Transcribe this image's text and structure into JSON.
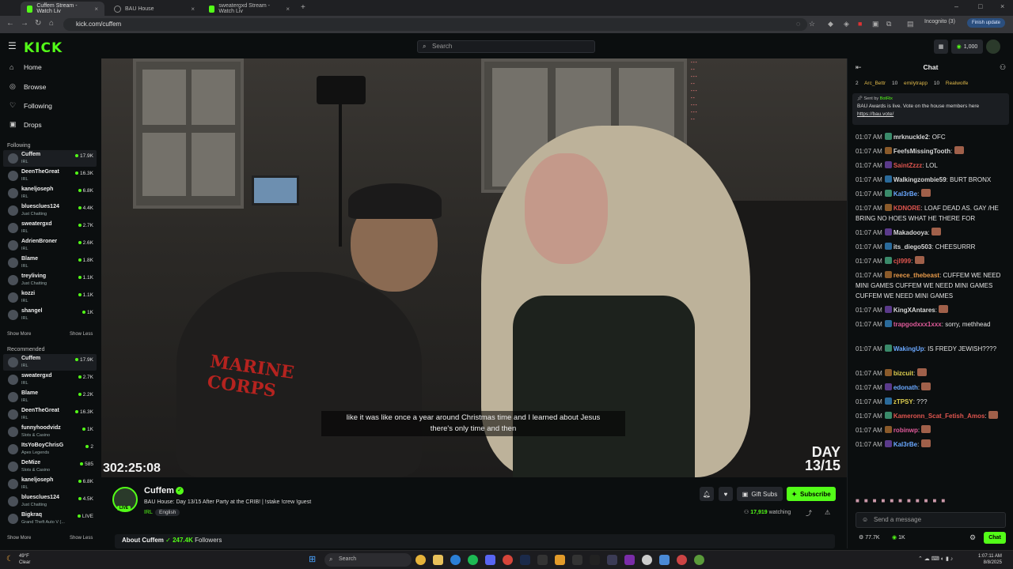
{
  "browser": {
    "tabs": [
      {
        "title": "Cuffem Stream - Watch Liv",
        "active": true
      },
      {
        "title": "BAU House",
        "active": false
      },
      {
        "title": "sweatergxd Stream - Watch Liv",
        "active": false
      }
    ],
    "url": "kick.com/cuffem",
    "incognito_label": "Incognito (3)",
    "finish_update": "Finish update"
  },
  "header": {
    "logo": "KICK",
    "search_placeholder": "Search",
    "balance": "1,000"
  },
  "sidebar": {
    "nav": [
      {
        "label": "Home",
        "icon": "home-icon"
      },
      {
        "label": "Browse",
        "icon": "compass-icon"
      },
      {
        "label": "Following",
        "icon": "heart-icon"
      },
      {
        "label": "Drops",
        "icon": "gift-icon"
      }
    ],
    "following_title": "Following",
    "following": [
      {
        "name": "Cuffem",
        "cat": "IRL",
        "viewers": "17.9K"
      },
      {
        "name": "DeenTheGreat",
        "cat": "IRL",
        "viewers": "16.3K"
      },
      {
        "name": "kaneljoseph",
        "cat": "IRL",
        "viewers": "6.8K"
      },
      {
        "name": "bluesclues124",
        "cat": "Just Chatting",
        "viewers": "4.4K"
      },
      {
        "name": "sweatergxd",
        "cat": "IRL",
        "viewers": "2.7K"
      },
      {
        "name": "AdrienBroner",
        "cat": "IRL",
        "viewers": "2.6K"
      },
      {
        "name": "Blame",
        "cat": "IRL",
        "viewers": "1.8K"
      },
      {
        "name": "treyliving",
        "cat": "Just Chatting",
        "viewers": "1.1K"
      },
      {
        "name": "kozzi",
        "cat": "IRL",
        "viewers": "1.1K"
      },
      {
        "name": "shangel",
        "cat": "IRL",
        "viewers": "1K"
      }
    ],
    "show_more": "Show More",
    "show_less": "Show Less",
    "recommended_title": "Recommended",
    "recommended": [
      {
        "name": "Cuffem",
        "cat": "IRL",
        "viewers": "17.9K"
      },
      {
        "name": "sweatergxd",
        "cat": "IRL",
        "viewers": "2.7K"
      },
      {
        "name": "Blame",
        "cat": "IRL",
        "viewers": "2.2K"
      },
      {
        "name": "DeenTheGreat",
        "cat": "IRL",
        "viewers": "16.3K"
      },
      {
        "name": "funnyhoodvidz",
        "cat": "Slots & Casino",
        "viewers": "1K"
      },
      {
        "name": "ItsYoBoyChrisG",
        "cat": "Apex Legends",
        "viewers": "2"
      },
      {
        "name": "DeMize",
        "cat": "Slots & Casino",
        "viewers": "585"
      },
      {
        "name": "kaneljoseph",
        "cat": "IRL",
        "viewers": "6.8K"
      },
      {
        "name": "bluesclues124",
        "cat": "Just Chatting",
        "viewers": "4.5K"
      },
      {
        "name": "Bigkraq",
        "cat": "Grand Theft Auto V (...",
        "viewers": "LIVE"
      }
    ]
  },
  "video": {
    "subtitle_line1": "like it was like once a year around Christmas time and I learned about Jesus",
    "subtitle_line2": "there's only time and then",
    "timer": "302:25:08",
    "day_badge_1": "DAY",
    "day_badge_2": "13/15",
    "shirt_text": "MARINE CORPS"
  },
  "stream": {
    "name": "Cuffem",
    "live": "LIVE",
    "title": "BAU House: Day 13/15 After Party at the CRIB! | !stake !crew !guest",
    "category": "IRL",
    "language": "English",
    "gift_subs": "Gift Subs",
    "subscribe": "Subscribe",
    "watching_count": "17,919",
    "watching_label": "watching",
    "about_prefix": "About Cuffem",
    "followers_count": "247.4K",
    "followers_label": "Followers"
  },
  "chat": {
    "title": "Chat",
    "gifters": [
      "2",
      "Arc_Bettr",
      "10",
      "emilytrapp",
      "10",
      "Realwolfe"
    ],
    "pinned_sent_by": "Sent by",
    "pinned_sender": "BotRix",
    "pinned_msg": "BAU Awards is live. Vote on the house members here",
    "pinned_link": "https://bau.vote/",
    "messages": [
      {
        "time": "01:07 AM",
        "user": "mrknuckle2",
        "color": "#d9d9d9",
        "text": "OFC"
      },
      {
        "time": "01:07 AM",
        "user": "FeefsMissingTooth",
        "color": "#d9d9d9",
        "text": ""
      },
      {
        "time": "01:07 AM",
        "user": "SaintZzzz",
        "color": "#e0554f",
        "text": "LOL"
      },
      {
        "time": "01:07 AM",
        "user": "Walkingzombie59",
        "color": "#d9d9d9",
        "text": "BURT BRONX"
      },
      {
        "time": "01:07 AM",
        "user": "Kal3rBe",
        "color": "#6aa8ff",
        "text": ""
      },
      {
        "time": "01:07 AM",
        "user": "KDNORE",
        "color": "#e0554f",
        "text": "LOAF DEAD AS. GAY /HE BRING NO HOES WHAT HE THERE FOR"
      },
      {
        "time": "01:07 AM",
        "user": "Makadooya",
        "color": "#d9d9d9",
        "text": ""
      },
      {
        "time": "01:07 AM",
        "user": "its_diego503",
        "color": "#d9d9d9",
        "text": "CHEESURRR"
      },
      {
        "time": "01:07 AM",
        "user": "cjl999",
        "color": "#e0554f",
        "text": ""
      },
      {
        "time": "01:07 AM",
        "user": "reece_thebeast",
        "color": "#e89a4a",
        "text": "CUFFEM WE NEED MINI GAMES CUFFEM WE NEED MINI GAMES CUFFEM WE NEED MINI GAMES"
      },
      {
        "time": "01:07 AM",
        "user": "KingXAntares",
        "color": "#d9d9d9",
        "text": ""
      },
      {
        "time": "01:07 AM",
        "user": "trapgodxxx1xxx",
        "color": "#e05a9a",
        "text": "sorry, methhead"
      },
      {
        "time": "01:07 AM",
        "user": "WakingUp",
        "color": "#6aa8ff",
        "text": "IS FREDY JEWISH????"
      },
      {
        "time": "01:07 AM",
        "user": "bizcuit",
        "color": "#e0d050",
        "text": ""
      },
      {
        "time": "01:07 AM",
        "user": "edonath",
        "color": "#6aa8ff",
        "text": ""
      },
      {
        "time": "01:07 AM",
        "user": "zTPSY",
        "color": "#e0d050",
        "text": "???"
      },
      {
        "time": "01:07 AM",
        "user": "Kameronn_Scat_Fetish_Amos",
        "color": "#e0554f",
        "text": ""
      },
      {
        "time": "01:07 AM",
        "user": "robinwp",
        "color": "#e05a9a",
        "text": ""
      },
      {
        "time": "01:07 AM",
        "user": "Kal3rBe",
        "color": "#6aa8ff",
        "text": ""
      }
    ],
    "input_placeholder": "Send a message",
    "stat_1": "77.7K",
    "stat_2": "1K",
    "send": "Chat"
  },
  "taskbar": {
    "temp": "49°F",
    "weather": "Clear",
    "search": "Search",
    "time": "1:07:11 AM",
    "date": "8/8/2025"
  }
}
